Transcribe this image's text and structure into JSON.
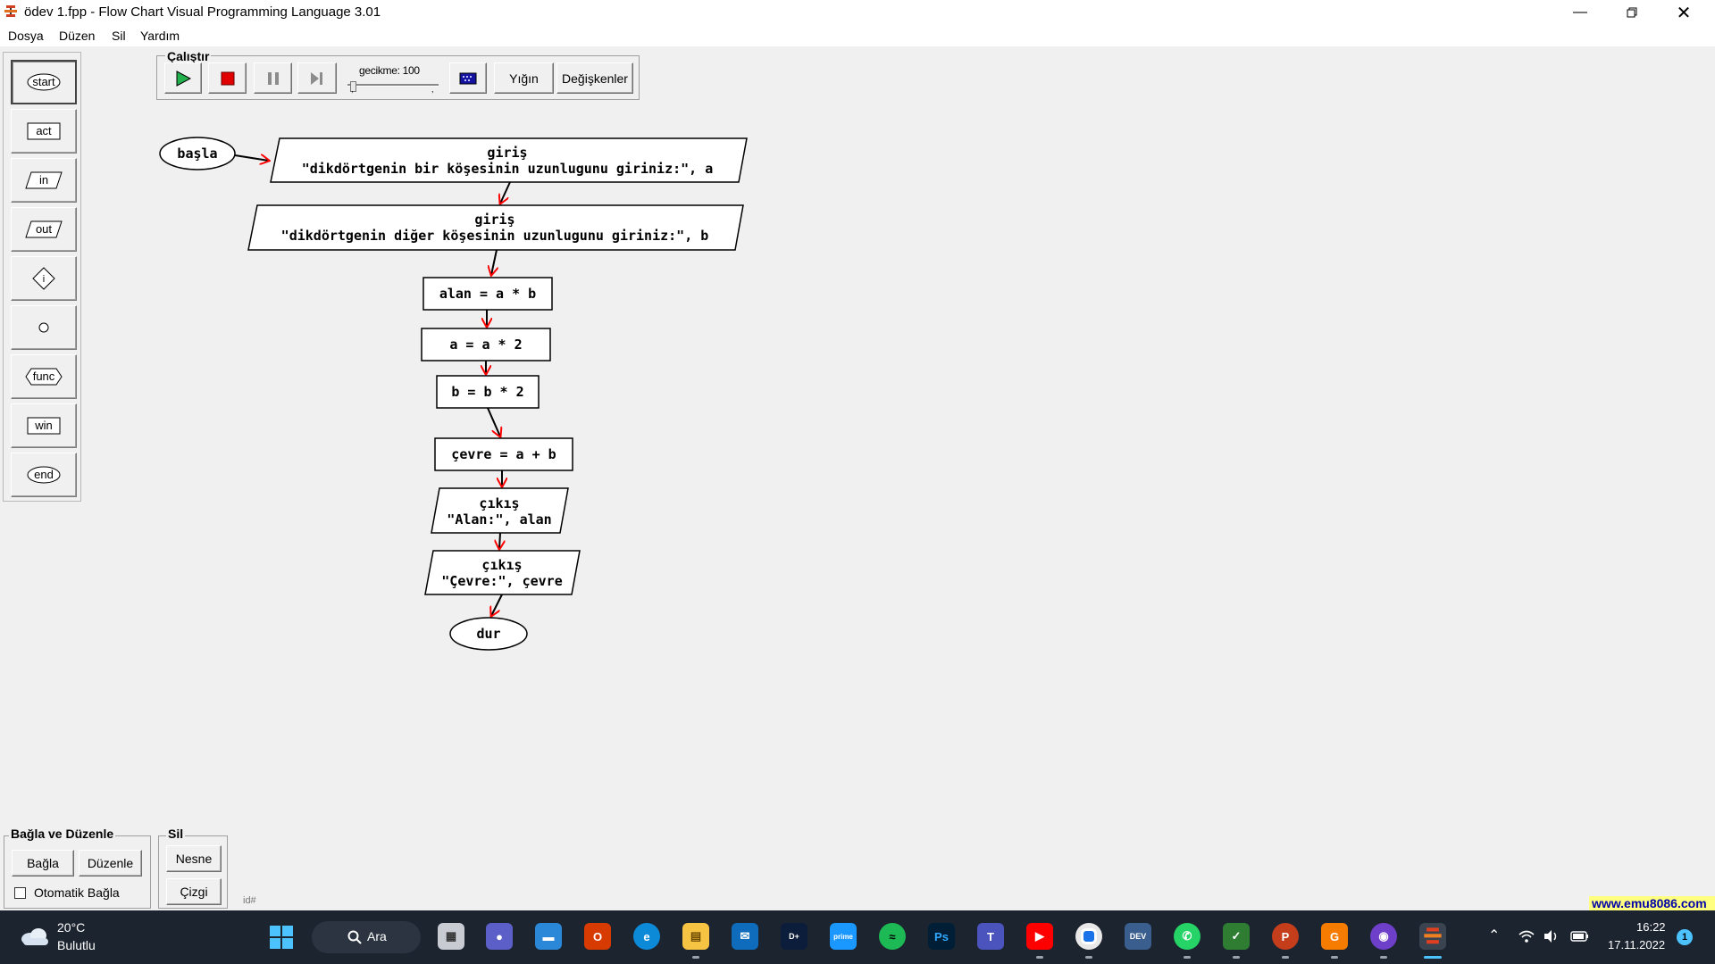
{
  "window": {
    "title": "ödev 1.fpp - Flow Chart Visual Programming Language 3.01"
  },
  "menu": [
    "Dosya",
    "Düzen",
    "Sil",
    "Yardım"
  ],
  "palette": [
    "start",
    "act",
    "in",
    "out",
    "if",
    "o",
    "func",
    "win",
    "end"
  ],
  "run_panel": {
    "legend": "Çalıştır",
    "delay_label": "gecikme: 100",
    "stack_button": "Yığın",
    "variables_button": "Değişkenler"
  },
  "flowchart": {
    "start": "başla",
    "input1": {
      "title": "giriş",
      "text": "\"dikdörtgenin bir köşesinin uzunlugunu giriniz:\", a"
    },
    "input2": {
      "title": "giriş",
      "text": "\"dikdörtgenin diğer köşesinin uzunlugunu giriniz:\", b"
    },
    "act1": "alan = a * b",
    "act2": "a = a * 2",
    "act3": "b = b * 2",
    "act4": "çevre = a + b",
    "output1": {
      "title": "çıkış",
      "text": "\"Alan:\", alan"
    },
    "output2": {
      "title": "çıkış",
      "text": "\"Çevre:\", çevre"
    },
    "end": "dur"
  },
  "connect_group": {
    "legend": "Bağla ve Düzenle",
    "connect_button": "Bağla",
    "arrange_button": "Düzenle",
    "auto_connect_label": "Otomatik Bağla",
    "auto_connect_checked": false
  },
  "delete_group": {
    "legend": "Sil",
    "object_button": "Nesne",
    "line_button": "Çizgi"
  },
  "status": {
    "id_label": "id#",
    "website": "www.emu8086.com"
  },
  "taskbar": {
    "weather_temp": "20°C",
    "weather_desc": "Bulutlu",
    "search_label": "Ara",
    "time": "16:22",
    "date": "17.11.2022",
    "notification_count": "1",
    "apps": [
      "task-view",
      "chat",
      "desktop",
      "office",
      "edge",
      "file-explorer",
      "mail",
      "disney-plus",
      "prime-video",
      "spotify",
      "photoshop",
      "teams",
      "youtube",
      "chrome",
      "dev-c",
      "whatsapp",
      "security",
      "powerpoint",
      "pdf-tool",
      "github",
      "flowchart-app"
    ]
  }
}
